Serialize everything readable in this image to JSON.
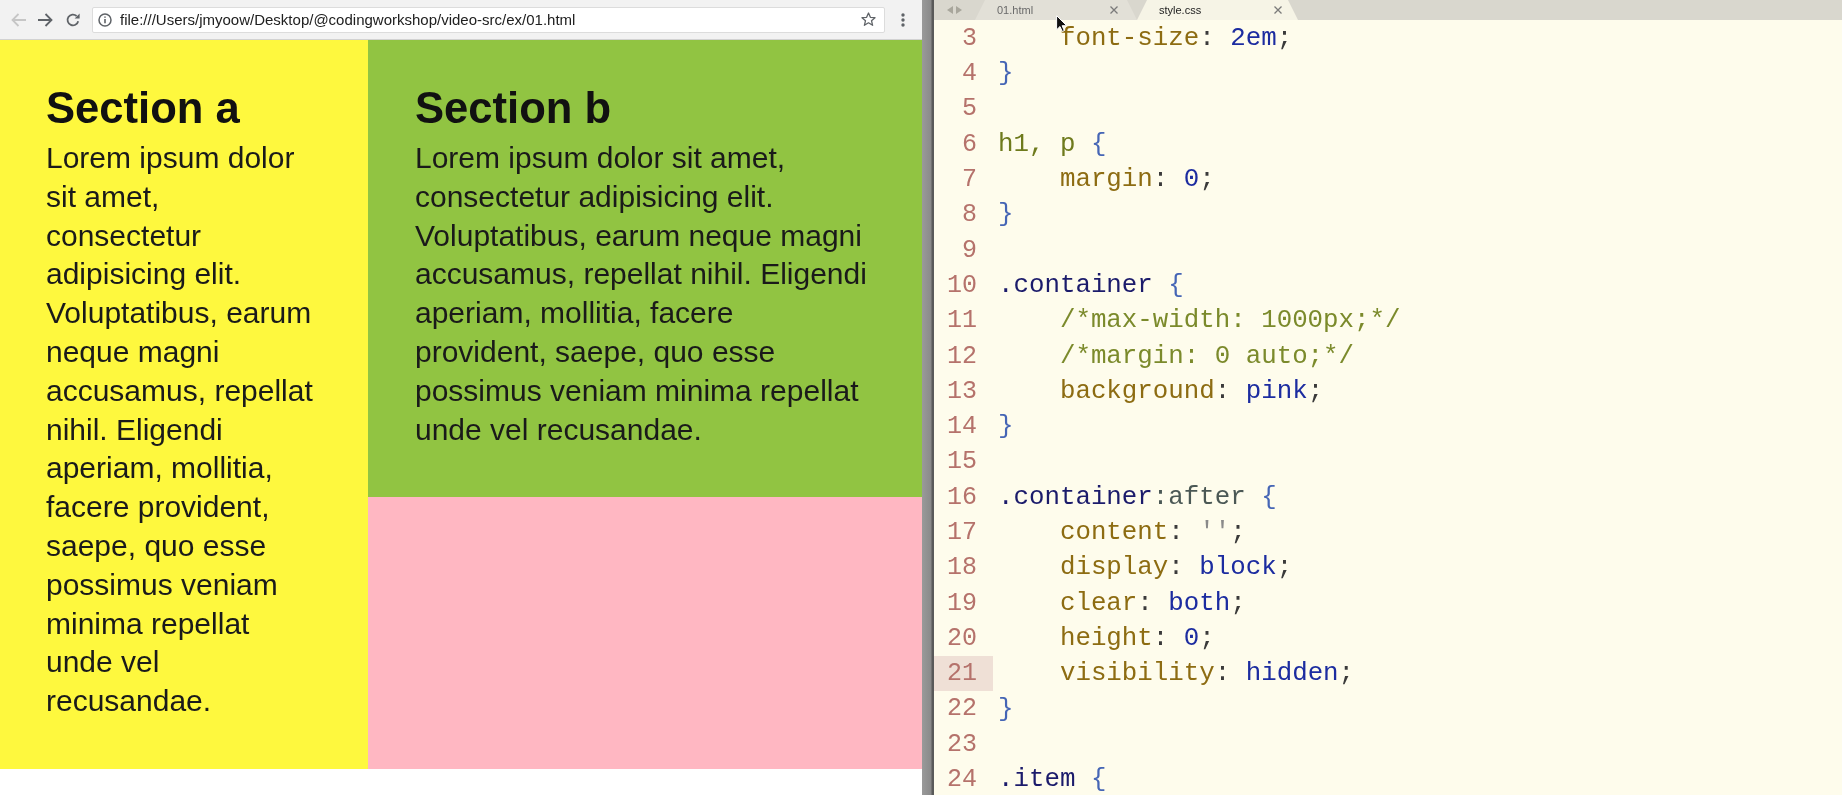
{
  "browser": {
    "nav_buttons": [
      {
        "kind": "back",
        "disabled": true
      },
      {
        "kind": "forward",
        "disabled": false
      },
      {
        "kind": "reload",
        "disabled": false
      }
    ],
    "url": "file:///Users/jmyoow/Desktop/@codingworkshop/video-src/ex/01.html"
  },
  "page": {
    "sections": [
      {
        "heading": "Section a",
        "text": "Lorem ipsum dolor sit amet, consectetur adipisicing elit. Voluptatibus, earum neque magni accusamus, repellat nihil. Eligendi aperiam, mollitia, facere provident, saepe, quo esse possimus veniam minima repellat unde vel recusandae.",
        "color": "#fef83e"
      },
      {
        "heading": "Section b",
        "text": "Lorem ipsum dolor sit amet, consectetur adipisicing elit. Voluptatibus, earum neque magni accusamus, repellat nihil. Eligendi aperiam, mollitia, facere provident, saepe, quo esse possimus veniam minima repellat unde vel recusandae.",
        "color": "#91c442"
      }
    ]
  },
  "editor": {
    "tabs": [
      {
        "label": "01.html",
        "selected": false
      },
      {
        "label": "style.css",
        "selected": true
      }
    ],
    "code_lines": [
      {
        "children": [
          {
            "number": "3",
            "current": false,
            "tokens": [
              {
                "text": "font-size",
                "kind": "property"
              },
              {
                "text": ": ",
                "kind": "punct"
              },
              {
                "text": "2em",
                "kind": "value"
              },
              {
                "text": ";",
                "kind": "punct"
              }
            ]
          }
        ]
      },
      {
        "number": "4",
        "current": false,
        "tokens": [
          {
            "text": "}",
            "kind": "brace"
          }
        ]
      },
      {
        "number": "5",
        "current": false
      },
      {
        "number": "6",
        "current": false,
        "tokens": [
          {
            "text": "h1, p",
            "kind": "tag"
          },
          {
            "text": " {",
            "kind": "brace"
          }
        ],
        "children": [
          {
            "number": "7",
            "current": false,
            "tokens": [
              {
                "text": "margin",
                "kind": "property"
              },
              {
                "text": ": ",
                "kind": "punct"
              },
              {
                "text": "0",
                "kind": "value"
              },
              {
                "text": ";",
                "kind": "punct"
              }
            ]
          }
        ]
      },
      {
        "number": "8",
        "current": false,
        "tokens": [
          {
            "text": "}",
            "kind": "brace"
          }
        ]
      },
      {
        "number": "9",
        "current": false
      },
      {
        "number": "10",
        "current": false,
        "tokens": [
          {
            "text": ".container",
            "kind": "class"
          },
          {
            "text": " {",
            "kind": "brace"
          }
        ],
        "children": [
          {
            "number": "11",
            "current": false,
            "tokens": [
              {
                "text": "/*max-width: 1000px;*/",
                "kind": "comment"
              }
            ]
          },
          {
            "number": "12",
            "current": false,
            "tokens": [
              {
                "text": "/*margin: 0 auto;*/",
                "kind": "comment"
              }
            ]
          },
          {
            "number": "13",
            "current": false,
            "tokens": [
              {
                "text": "background",
                "kind": "property"
              },
              {
                "text": ": ",
                "kind": "punct"
              },
              {
                "text": "pink",
                "kind": "value"
              },
              {
                "text": ";",
                "kind": "punct"
              }
            ]
          }
        ]
      },
      {
        "number": "14",
        "current": false,
        "tokens": [
          {
            "text": "}",
            "kind": "brace"
          }
        ]
      },
      {
        "number": "15",
        "current": false
      },
      {
        "number": "16",
        "current": false,
        "tokens": [
          {
            "text": ".container",
            "kind": "class"
          },
          {
            "text": ":after",
            "kind": "pseudo"
          },
          {
            "text": " {",
            "kind": "brace"
          }
        ],
        "children": [
          {
            "number": "17",
            "current": false,
            "tokens": [
              {
                "text": "content",
                "kind": "property"
              },
              {
                "text": ": ",
                "kind": "punct"
              },
              {
                "text": "''",
                "kind": "string"
              },
              {
                "text": ";",
                "kind": "punct"
              }
            ]
          },
          {
            "number": "18",
            "current": false,
            "tokens": [
              {
                "text": "display",
                "kind": "property"
              },
              {
                "text": ": ",
                "kind": "punct"
              },
              {
                "text": "block",
                "kind": "value"
              },
              {
                "text": ";",
                "kind": "punct"
              }
            ]
          },
          {
            "number": "19",
            "current": false,
            "tokens": [
              {
                "text": "clear",
                "kind": "property"
              },
              {
                "text": ": ",
                "kind": "punct"
              },
              {
                "text": "both",
                "kind": "value"
              },
              {
                "text": ";",
                "kind": "punct"
              }
            ]
          },
          {
            "number": "20",
            "current": false,
            "tokens": [
              {
                "text": "height",
                "kind": "property"
              },
              {
                "text": ": ",
                "kind": "punct"
              },
              {
                "text": "0",
                "kind": "value"
              },
              {
                "text": ";",
                "kind": "punct"
              }
            ]
          },
          {
            "number": "21",
            "current": true,
            "tokens": [
              {
                "text": "visibility",
                "kind": "property"
              },
              {
                "text": ": ",
                "kind": "punct"
              },
              {
                "text": "hidden",
                "kind": "value"
              },
              {
                "text": ";",
                "kind": "punct"
              }
            ]
          }
        ]
      },
      {
        "number": "22",
        "current": false,
        "tokens": [
          {
            "text": "}",
            "kind": "brace"
          }
        ]
      },
      {
        "number": "23",
        "current": false
      },
      {
        "number": "24",
        "current": false,
        "tokens": [
          {
            "text": ".item",
            "kind": "class"
          },
          {
            "text": " {",
            "kind": "brace"
          }
        ]
      }
    ]
  }
}
